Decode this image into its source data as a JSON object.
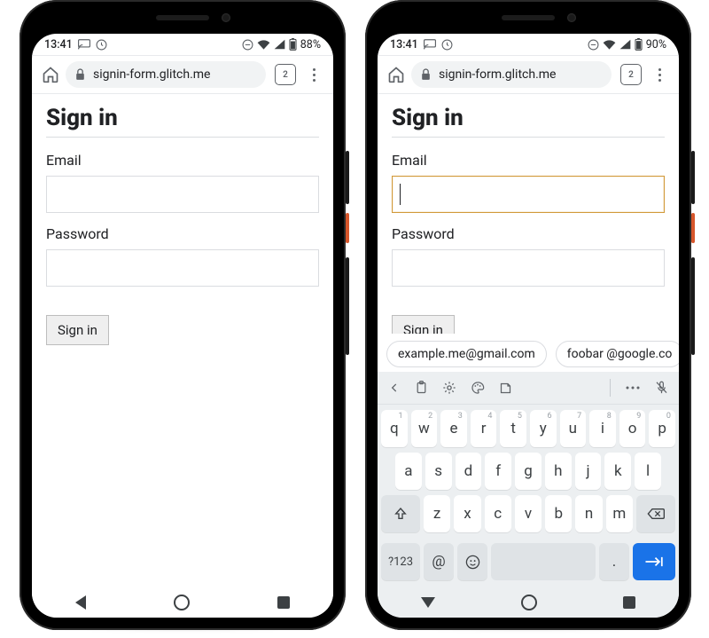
{
  "left": {
    "status": {
      "time": "13:41",
      "battery": "88%"
    },
    "addr": {
      "url": "signin-form.glitch.me",
      "tab_count": "2"
    },
    "page": {
      "title": "Sign in",
      "email_label": "Email",
      "password_label": "Password",
      "button_label": "Sign in"
    }
  },
  "right": {
    "status": {
      "time": "13:41",
      "battery": "90%"
    },
    "addr": {
      "url": "signin-form.glitch.me",
      "tab_count": "2"
    },
    "page": {
      "title": "Sign in",
      "email_label": "Email",
      "password_label": "Password",
      "button_label": "Sign in"
    },
    "suggestions": [
      "example.me@gmail.com",
      "foobar @google.co"
    ],
    "keyboard": {
      "row1": [
        [
          "q",
          "1"
        ],
        [
          "w",
          "2"
        ],
        [
          "e",
          "3"
        ],
        [
          "r",
          "4"
        ],
        [
          "t",
          "5"
        ],
        [
          "y",
          "6"
        ],
        [
          "u",
          "7"
        ],
        [
          "i",
          "8"
        ],
        [
          "o",
          "9"
        ],
        [
          "p",
          "0"
        ]
      ],
      "row2": [
        "a",
        "s",
        "d",
        "f",
        "g",
        "h",
        "j",
        "k",
        "l"
      ],
      "row3": [
        "z",
        "x",
        "c",
        "v",
        "b",
        "n",
        "m"
      ],
      "sym_key": "?123",
      "at_key": "@",
      "period_key": "."
    }
  }
}
